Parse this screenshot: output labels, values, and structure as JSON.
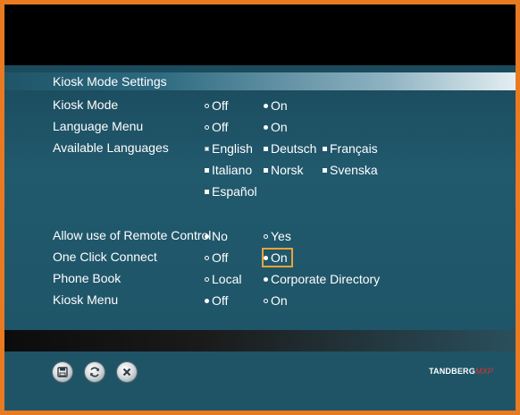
{
  "window": {
    "title": "Kiosk Mode Settings"
  },
  "settings": {
    "kiosk_mode": {
      "label": "Kiosk Mode",
      "options": [
        "Off",
        "On"
      ],
      "selected": "On"
    },
    "language_menu": {
      "label": "Language Menu",
      "options": [
        "Off",
        "On"
      ],
      "selected": "On"
    },
    "available_languages": {
      "label": "Available Languages",
      "options": [
        "English",
        "Deutsch",
        "Français",
        "Italiano",
        "Norsk",
        "Svenska",
        "Español"
      ]
    },
    "remote_control": {
      "label": "Allow use of Remote Control",
      "options": [
        "No",
        "Yes"
      ],
      "selected": "No"
    },
    "one_click_connect": {
      "label": "One Click Connect",
      "options": [
        "Off",
        "On"
      ],
      "selected": "On"
    },
    "phone_book": {
      "label": "Phone Book",
      "options": [
        "Local",
        "Corporate Directory"
      ],
      "selected": "Corporate Directory"
    },
    "kiosk_menu": {
      "label": "Kiosk Menu",
      "options": [
        "Off",
        "On"
      ],
      "selected": "Off"
    }
  },
  "footer": {
    "icons": [
      "save-icon",
      "refresh-icon",
      "close-icon"
    ],
    "brand": "TANDBERG",
    "brand_suffix": "MXP"
  },
  "colors": {
    "border": "#e87a22",
    "panel": "#1f5466",
    "focus": "#e8a33c",
    "brand_suffix": "#e0312f"
  }
}
